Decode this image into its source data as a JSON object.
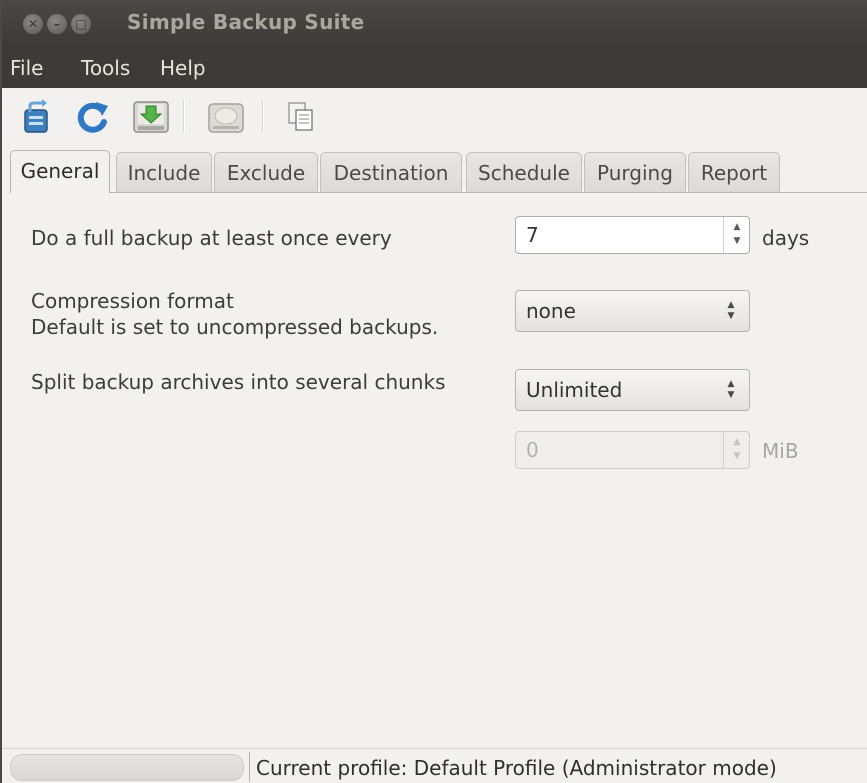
{
  "window": {
    "title": "Simple Backup Suite"
  },
  "menu": {
    "items": [
      "File",
      "Tools",
      "Help"
    ]
  },
  "toolbar": {
    "icons": [
      "new-profile-icon",
      "refresh-icon",
      "save-icon",
      "backup-drive-icon",
      "copy-icon"
    ]
  },
  "tabs": [
    "General",
    "Include",
    "Exclude",
    "Destination",
    "Schedule",
    "Purging",
    "Report"
  ],
  "active_tab": "General",
  "general": {
    "full_backup_label": "Do a full backup at least once every",
    "full_backup_value": "7",
    "full_backup_unit": "days",
    "compression_label": "Compression format",
    "compression_sublabel": "Default is set to uncompressed backups.",
    "compression_value": "none",
    "split_label": "Split backup archives into several chunks",
    "split_value": "Unlimited",
    "chunk_size_value": "0",
    "chunk_size_unit": "MiB"
  },
  "status": {
    "text": "Current profile: Default Profile  (Administrator mode)"
  }
}
